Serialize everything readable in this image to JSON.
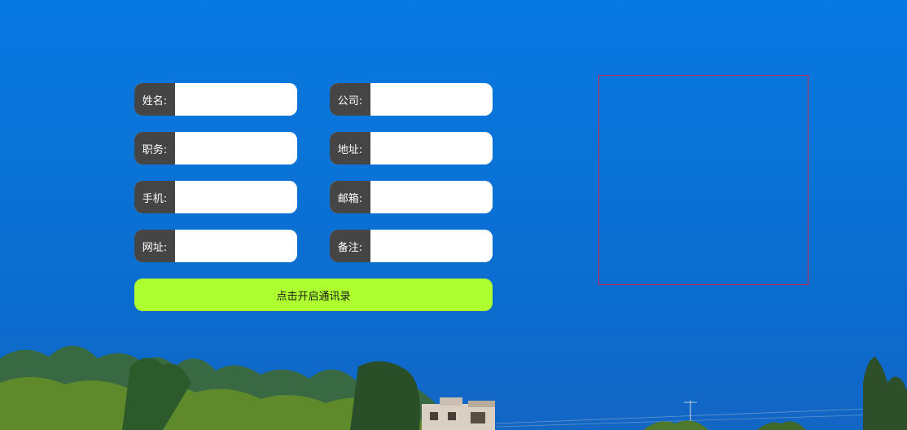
{
  "form": {
    "fields": [
      {
        "label": "姓名:",
        "value": "",
        "placeholder": ""
      },
      {
        "label": "公司:",
        "value": "",
        "placeholder": ""
      },
      {
        "label": "职务:",
        "value": "",
        "placeholder": ""
      },
      {
        "label": "地址:",
        "value": "",
        "placeholder": ""
      },
      {
        "label": "手机:",
        "value": "",
        "placeholder": ""
      },
      {
        "label": "邮箱:",
        "value": "",
        "placeholder": ""
      },
      {
        "label": "网址:",
        "value": "",
        "placeholder": ""
      },
      {
        "label": "备注:",
        "value": "",
        "placeholder": ""
      }
    ],
    "submit_label": "点击开启通讯录"
  },
  "colors": {
    "label_bg": "#454545",
    "submit_bg": "#adff2f",
    "qr_border": "#c8294a",
    "background": "#0878e2"
  }
}
